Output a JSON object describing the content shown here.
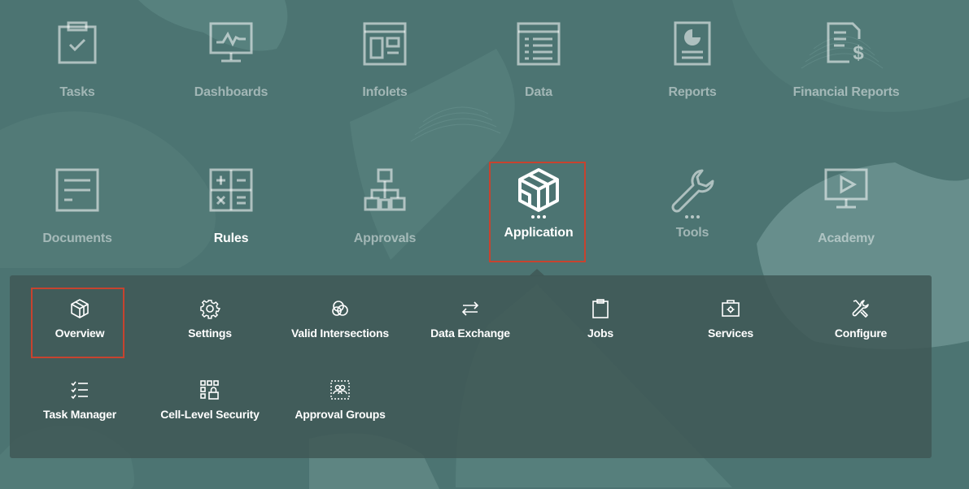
{
  "colors": {
    "background": "#4c7472",
    "panel": "#405856",
    "selection_border": "#c7432f",
    "active_text": "#ffffff"
  },
  "main_nav": [
    {
      "label": "Tasks",
      "icon": "clipboard-check-icon"
    },
    {
      "label": "Dashboards",
      "icon": "monitor-chart-icon"
    },
    {
      "label": "Infolets",
      "icon": "layout-panels-icon"
    },
    {
      "label": "Data",
      "icon": "data-grid-icon"
    },
    {
      "label": "Reports",
      "icon": "report-pie-icon"
    },
    {
      "label": "Financial Reports",
      "icon": "document-dollar-icon"
    },
    {
      "label": "Documents",
      "icon": "document-lines-icon"
    },
    {
      "label": "Rules",
      "icon": "calculator-icon"
    },
    {
      "label": "Approvals",
      "icon": "hierarchy-icon"
    },
    {
      "label": "Application",
      "icon": "cube-icon",
      "selected": true
    },
    {
      "label": "Tools",
      "icon": "wrench-icon"
    },
    {
      "label": "Academy",
      "icon": "video-play-icon"
    }
  ],
  "submenu": [
    {
      "label": "Overview",
      "icon": "cube-icon",
      "selected": true
    },
    {
      "label": "Settings",
      "icon": "gear-icon"
    },
    {
      "label": "Valid Intersections",
      "icon": "intersections-icon"
    },
    {
      "label": "Data Exchange",
      "icon": "exchange-arrows-icon"
    },
    {
      "label": "Jobs",
      "icon": "clipboard-icon"
    },
    {
      "label": "Services",
      "icon": "services-box-icon"
    },
    {
      "label": "Configure",
      "icon": "tools-icon"
    },
    {
      "label": "Task Manager",
      "icon": "checklist-icon"
    },
    {
      "label": "Cell-Level Security",
      "icon": "cell-security-icon"
    },
    {
      "label": "Approval Groups",
      "icon": "group-users-icon"
    }
  ]
}
